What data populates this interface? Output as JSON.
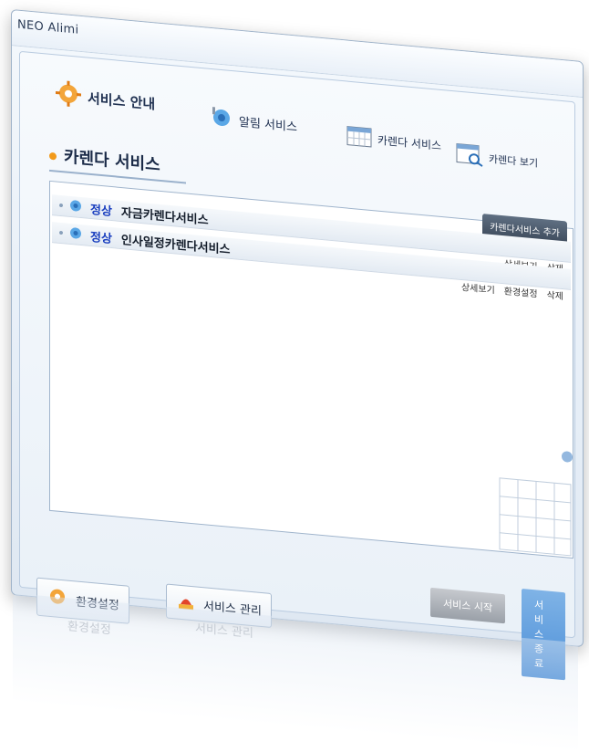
{
  "window": {
    "title": "NEO Alimi",
    "close": "x"
  },
  "tabs": [
    {
      "label": "서비스 안내",
      "icon": "gear-icon"
    },
    {
      "label": "알림 서비스",
      "icon": "alarm-service-icon"
    },
    {
      "label": "카렌다 서비스",
      "icon": "calendar-icon"
    },
    {
      "label": "카렌다 보기",
      "icon": "calendar-view-icon"
    }
  ],
  "section": {
    "title": "카렌다 서비스"
  },
  "panel": {
    "add_button": "카렌다서비스 추가",
    "rows": [
      {
        "status": "정상",
        "name": "자금카렌다서비스",
        "actions": [
          "상세보기",
          "삭제"
        ]
      },
      {
        "status": "정상",
        "name": "인사일정카렌다서비스",
        "actions": [
          "상세보기",
          "환경설정",
          "삭제"
        ]
      }
    ]
  },
  "controls": {
    "start": "서비스 시작",
    "stop": "서비스 종료"
  },
  "bottom": {
    "settings": "환경설정",
    "manage": "서비스 관리"
  },
  "colors": {
    "status": "#1a3fbf",
    "accent": "#f29a1a",
    "stop_button": "#4c8fd8"
  }
}
